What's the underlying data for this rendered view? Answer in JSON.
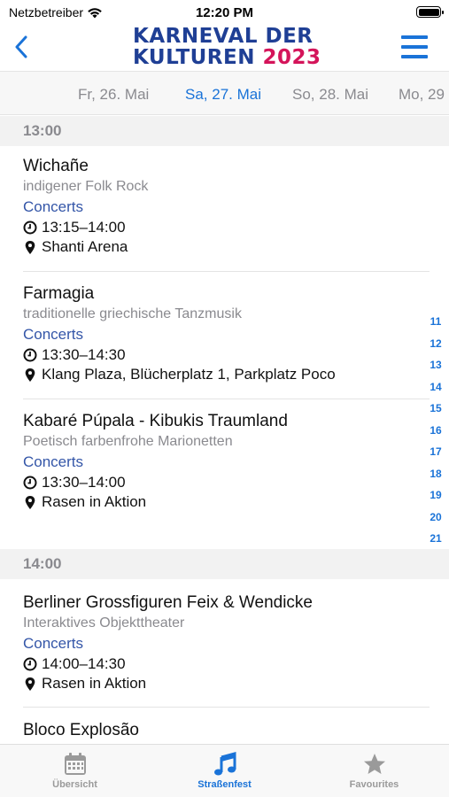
{
  "status_bar": {
    "carrier": "Netzbetreiber",
    "time": "12:20 PM"
  },
  "header": {
    "back_icon": "chevron-left-icon",
    "logo_line1": "KARNEVAL DER",
    "logo_line2": "KULTUREN",
    "logo_year": "2023",
    "menu_icon": "hamburger-icon",
    "accent_color": "#1a73d8",
    "logo_color": "#1f3f95",
    "year_color": "#d4145a"
  },
  "days": [
    {
      "label": "Fr, 26. Mai",
      "active": false
    },
    {
      "label": "Sa, 27. Mai",
      "active": true
    },
    {
      "label": "So, 28. Mai",
      "active": false
    },
    {
      "label": "Mo, 29",
      "active": false
    }
  ],
  "sections": [
    {
      "time": "13:00"
    },
    {
      "time": "14:00"
    }
  ],
  "events": [
    {
      "title": "Wichañe",
      "subtitle": "indigener Folk Rock",
      "category": "Concerts",
      "time": "13:15–14:00",
      "location": "Shanti Arena"
    },
    {
      "title": "Farmagia",
      "subtitle": "traditionelle griechische Tanzmusik",
      "category": "Concerts",
      "time": "13:30–14:30",
      "location": "Klang Plaza, Blücherplatz 1, Parkplatz Poco"
    },
    {
      "title": "Kabaré Púpala - Kibukis Traumland",
      "subtitle": "Poetisch farbenfrohe Marionetten",
      "category": "Concerts",
      "time": "13:30–14:00",
      "location": "Rasen in Aktion"
    },
    {
      "title": "Berliner Grossfiguren Feix & Wendicke",
      "subtitle": "Interaktives Objekttheater",
      "category": "Concerts",
      "time": "14:00–14:30",
      "location": "Rasen in Aktion"
    },
    {
      "title": "Bloco Explosão"
    }
  ],
  "index": [
    "11",
    "12",
    "13",
    "14",
    "15",
    "16",
    "17",
    "18",
    "19",
    "20",
    "21"
  ],
  "tabs": [
    {
      "label": "Übersicht",
      "icon": "calendar-icon",
      "active": false
    },
    {
      "label": "Straßenfest",
      "icon": "music-note-icon",
      "active": true
    },
    {
      "label": "Favourites",
      "icon": "star-icon",
      "active": false
    }
  ]
}
